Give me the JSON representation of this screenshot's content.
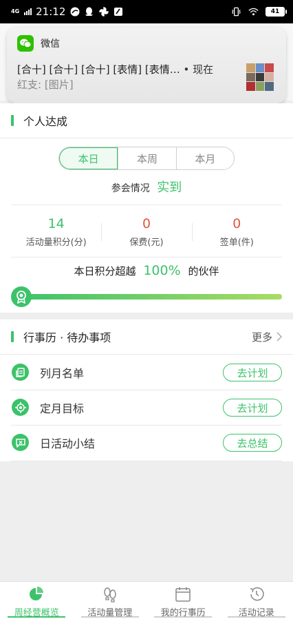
{
  "status_bar": {
    "network": "4G",
    "time": "21:12",
    "battery": "41"
  },
  "notification": {
    "app_name": "微信",
    "message": "[合十] [合十] [合十] [表情] [表情…",
    "time": "• 现在",
    "sender": "红支:",
    "sub_message": "[图片]"
  },
  "achievement": {
    "title": "个人达成",
    "tabs": [
      "本日",
      "本周",
      "本月"
    ],
    "active_tab": 0,
    "attendance_label": "参会情况",
    "attendance_value": "实到",
    "stats": [
      {
        "value": "14",
        "label": "活动量积分(分)",
        "color": "green"
      },
      {
        "value": "0",
        "label": "保费(元)",
        "color": "red"
      },
      {
        "value": "0",
        "label": "签单(件)",
        "color": "red"
      }
    ],
    "beat_prefix": "本日积分超越",
    "beat_value": "100%",
    "beat_suffix": "的伙伴",
    "progress_fraction": 1.0,
    "accent_color": "#3cc26a"
  },
  "calendar": {
    "title": "行事历 · 待办事项",
    "more": "更多",
    "todos": [
      {
        "label": "列月名单",
        "button": "去计划",
        "icon": "list-icon"
      },
      {
        "label": "定月目标",
        "button": "去计划",
        "icon": "target-icon"
      },
      {
        "label": "日活动小结",
        "button": "去总结",
        "icon": "summary-icon"
      }
    ]
  },
  "bottom_nav": {
    "items": [
      {
        "label": "周经营概览",
        "icon": "pie-chart-icon",
        "active": true
      },
      {
        "label": "活动量管理",
        "icon": "footprints-icon",
        "active": false
      },
      {
        "label": "我的行事历",
        "icon": "calendar-icon",
        "active": false
      },
      {
        "label": "活动记录",
        "icon": "history-icon",
        "active": false
      }
    ]
  }
}
